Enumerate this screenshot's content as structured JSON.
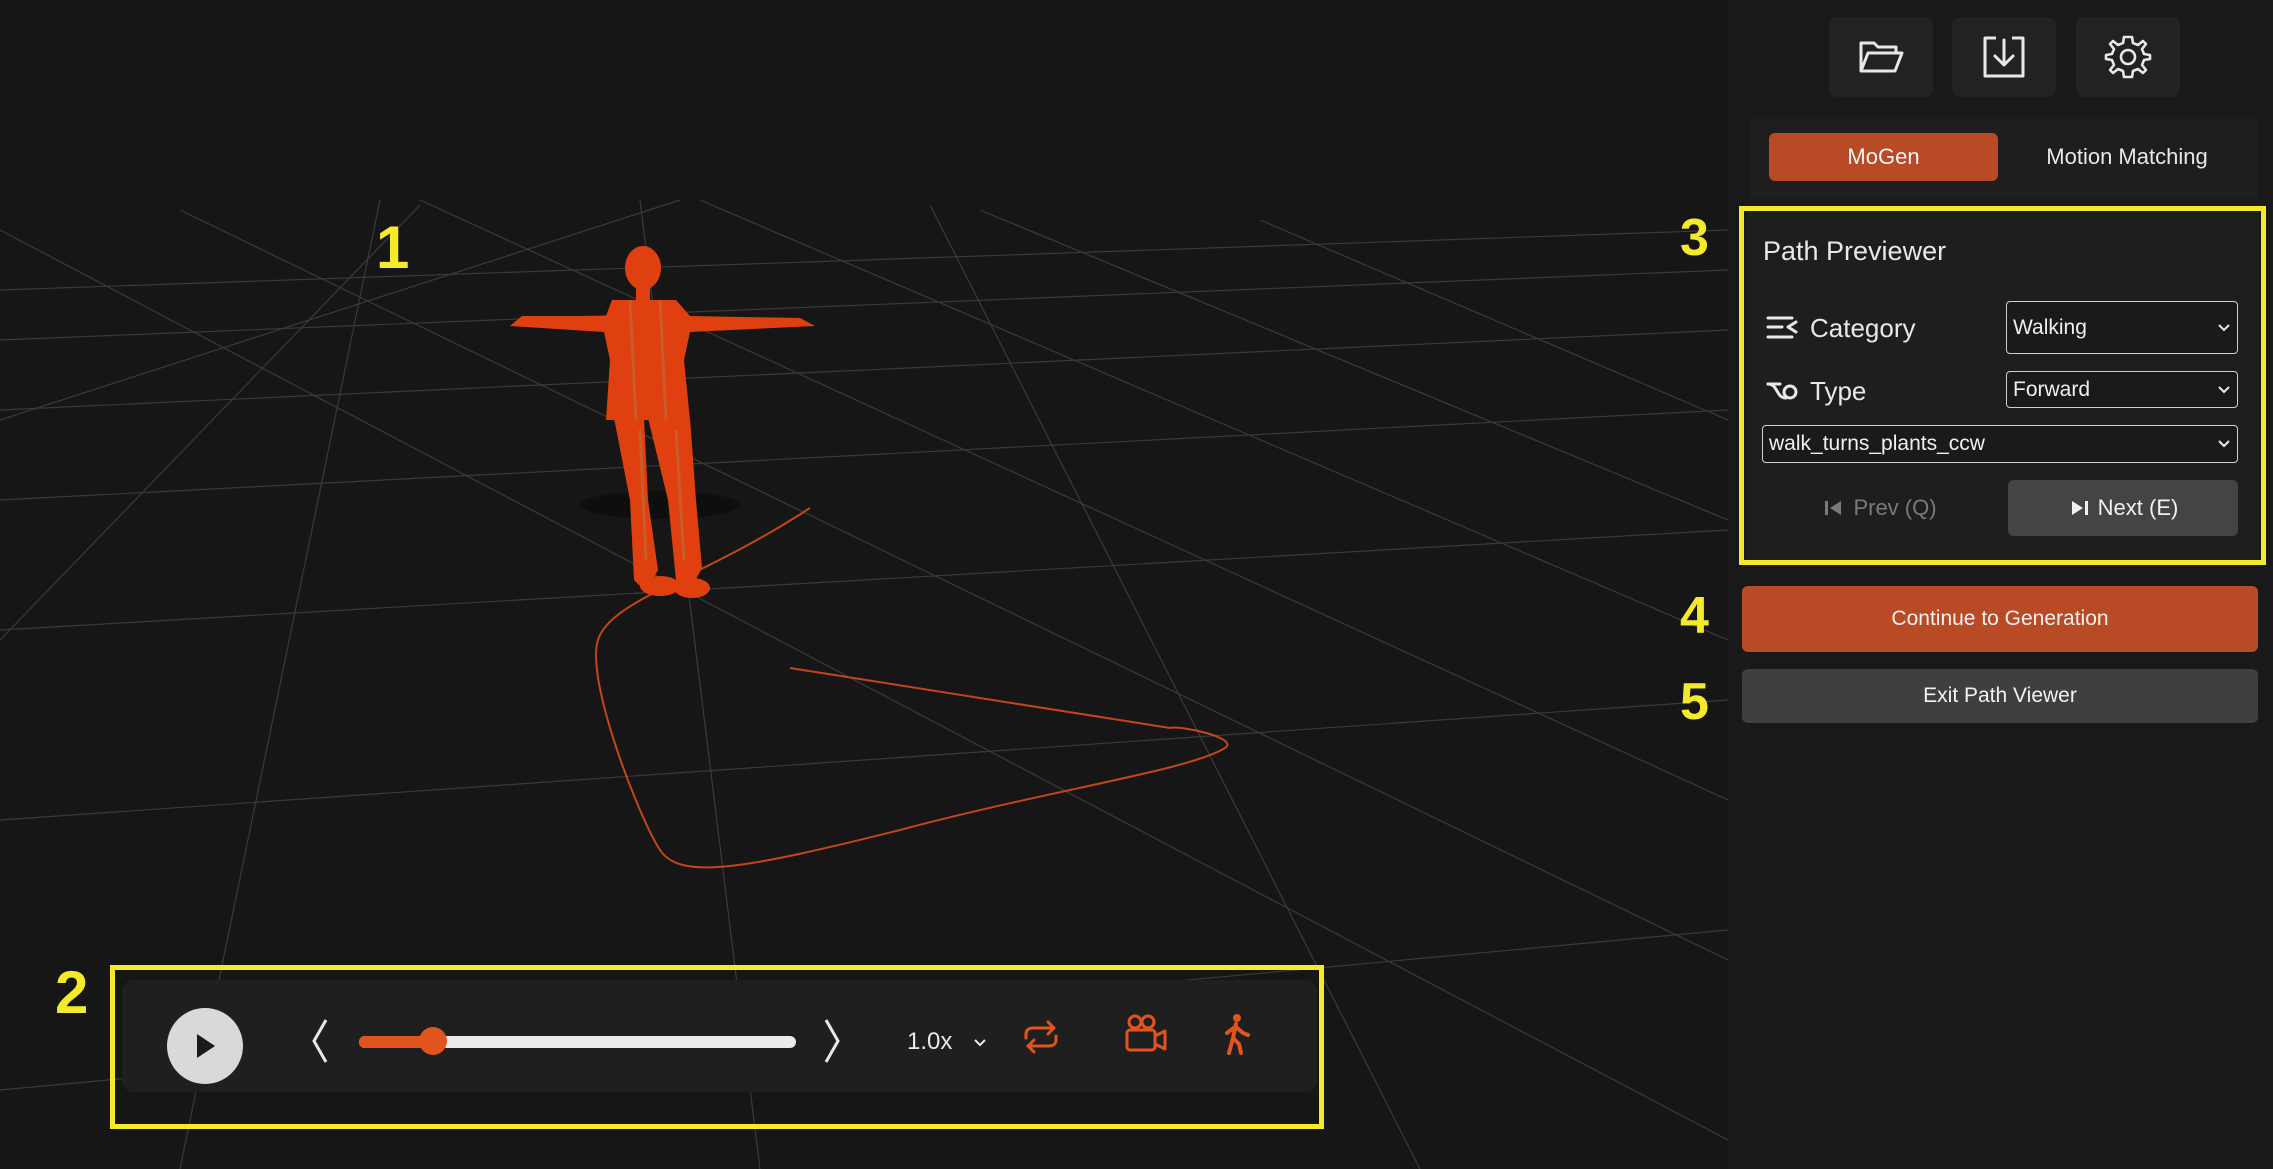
{
  "annotations": [
    "1",
    "2",
    "3",
    "4",
    "5"
  ],
  "playback": {
    "progress": 0.17,
    "speed": "1.0x",
    "icons": [
      "play-icon",
      "chevron-left-icon",
      "chevron-right-icon",
      "chevron-down-icon",
      "loop-icon",
      "camera-icon",
      "walking-figure-icon"
    ]
  },
  "toolbar": {
    "icons": [
      "folder-open-icon",
      "download-icon",
      "settings-gear-icon"
    ]
  },
  "tabs": [
    {
      "label": "MoGen",
      "active": true
    },
    {
      "label": "Motion Matching",
      "active": false
    }
  ],
  "path_previewer": {
    "title": "Path Previewer",
    "category_label": "Category",
    "category_value": "Walking",
    "type_label": "Type",
    "type_value": "Forward",
    "motion_value": "walk_turns_plants_ccw",
    "prev_label": "Prev (Q)",
    "next_label": "Next (E)"
  },
  "continue_label": "Continue to Generation",
  "exit_label": "Exit Path Viewer",
  "colors": {
    "accent": "#b84a25",
    "highlight": "#f5ea2a",
    "character": "#e0400f"
  }
}
